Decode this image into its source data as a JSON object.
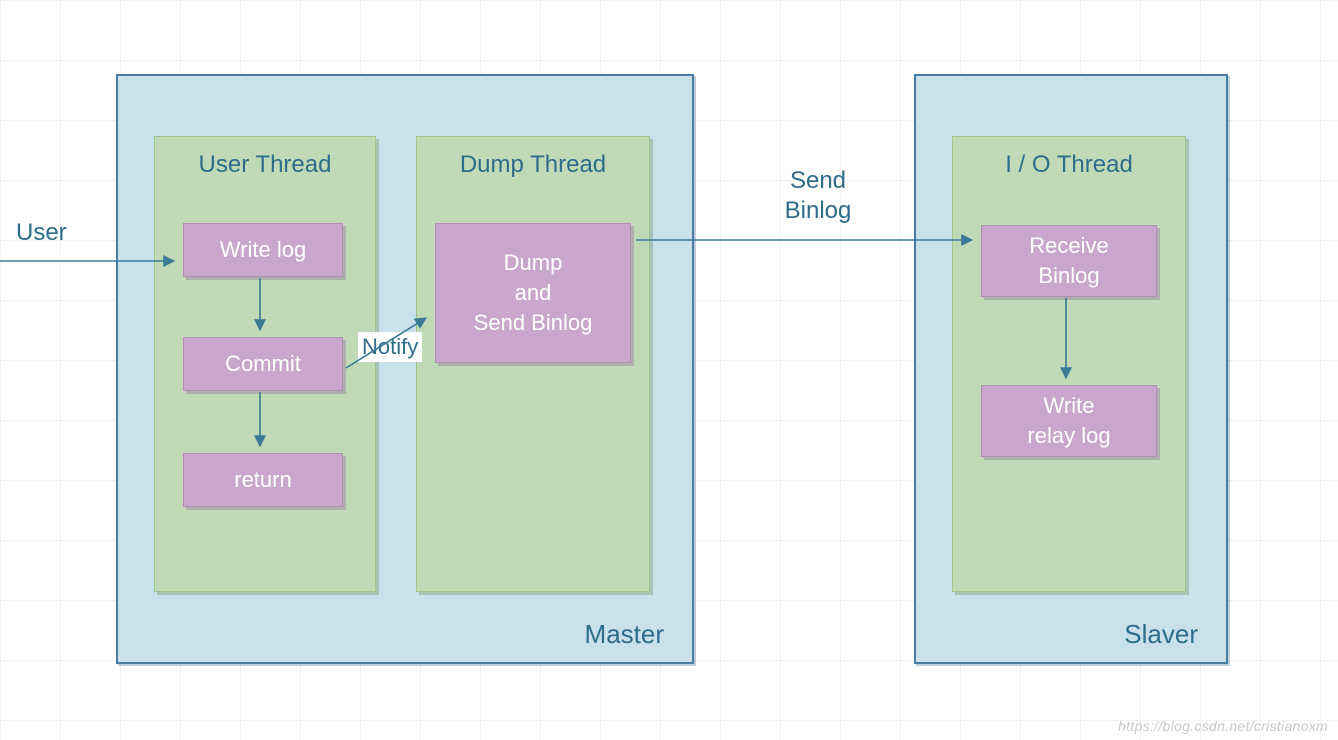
{
  "labels": {
    "user": "User",
    "notify": "Notify",
    "send_binlog_l1": "Send",
    "send_binlog_l2": "Binlog"
  },
  "master": {
    "label": "Master",
    "user_thread": {
      "title": "User Thread",
      "write_log": "Write log",
      "commit": "Commit",
      "ret": "return"
    },
    "dump_thread": {
      "title": "Dump Thread",
      "dump_send": "Dump\nand\nSend  Binlog"
    }
  },
  "slaver": {
    "label": "Slaver",
    "io_thread": {
      "title": "I / O Thread",
      "receive": "Receive\nBinlog",
      "write_relay": "Write\nrelay log"
    }
  },
  "watermark": "https://blog.csdn.net/cristianoxm",
  "colors": {
    "container_bg": "#c8e1ea",
    "container_border": "#4a7ea0",
    "thread_bg": "#c0d9b7",
    "box_bg": "#c9a7cc",
    "text": "#2e6d89"
  }
}
